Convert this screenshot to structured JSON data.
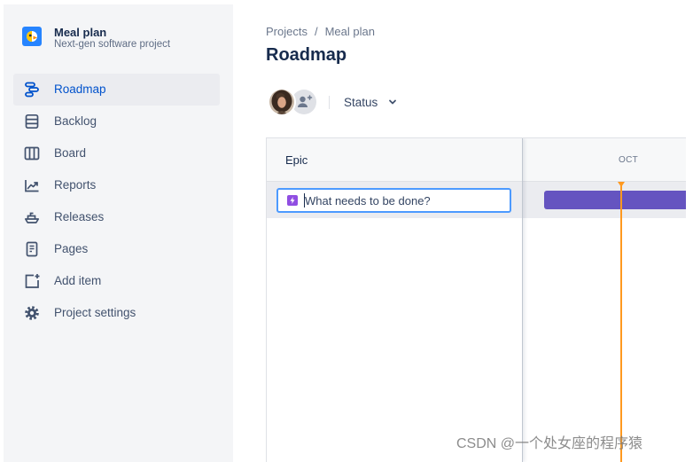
{
  "project": {
    "name": "Meal plan",
    "type": "Next-gen software project",
    "avatar_icon": "project-avatar-icon"
  },
  "sidebar": {
    "items": [
      {
        "label": "Roadmap",
        "icon": "roadmap-icon",
        "selected": true
      },
      {
        "label": "Backlog",
        "icon": "backlog-icon"
      },
      {
        "label": "Board",
        "icon": "board-icon"
      },
      {
        "label": "Reports",
        "icon": "reports-icon"
      },
      {
        "label": "Releases",
        "icon": "releases-icon"
      },
      {
        "label": "Pages",
        "icon": "pages-icon"
      },
      {
        "label": "Add item",
        "icon": "add-item-icon"
      },
      {
        "label": "Project settings",
        "icon": "settings-icon"
      }
    ]
  },
  "breadcrumb": {
    "items": [
      "Projects",
      "Meal plan"
    ],
    "separator": "/"
  },
  "page": {
    "title": "Roadmap"
  },
  "toolbar": {
    "avatars": [
      "user-photo-avatar",
      "add-people-icon"
    ],
    "status_filter_label": "Status",
    "status_filter_icon": "chevron-down-icon"
  },
  "roadmap": {
    "epic_column_header": "Epic",
    "timeline_months": [
      "OCT"
    ],
    "new_epic_input": {
      "placeholder": "What needs to be done?",
      "icon": "epic-lightning-icon"
    }
  },
  "watermark": "CSDN @一个处女座的程序猿",
  "colors": {
    "accent": "#0052CC",
    "epic-bar": "#6554C0",
    "today-marker": "#FF991F",
    "input-focus": "#4C9AFF",
    "epic-icon": "#904EE2",
    "sidebar-bg": "#F4F5F7"
  }
}
